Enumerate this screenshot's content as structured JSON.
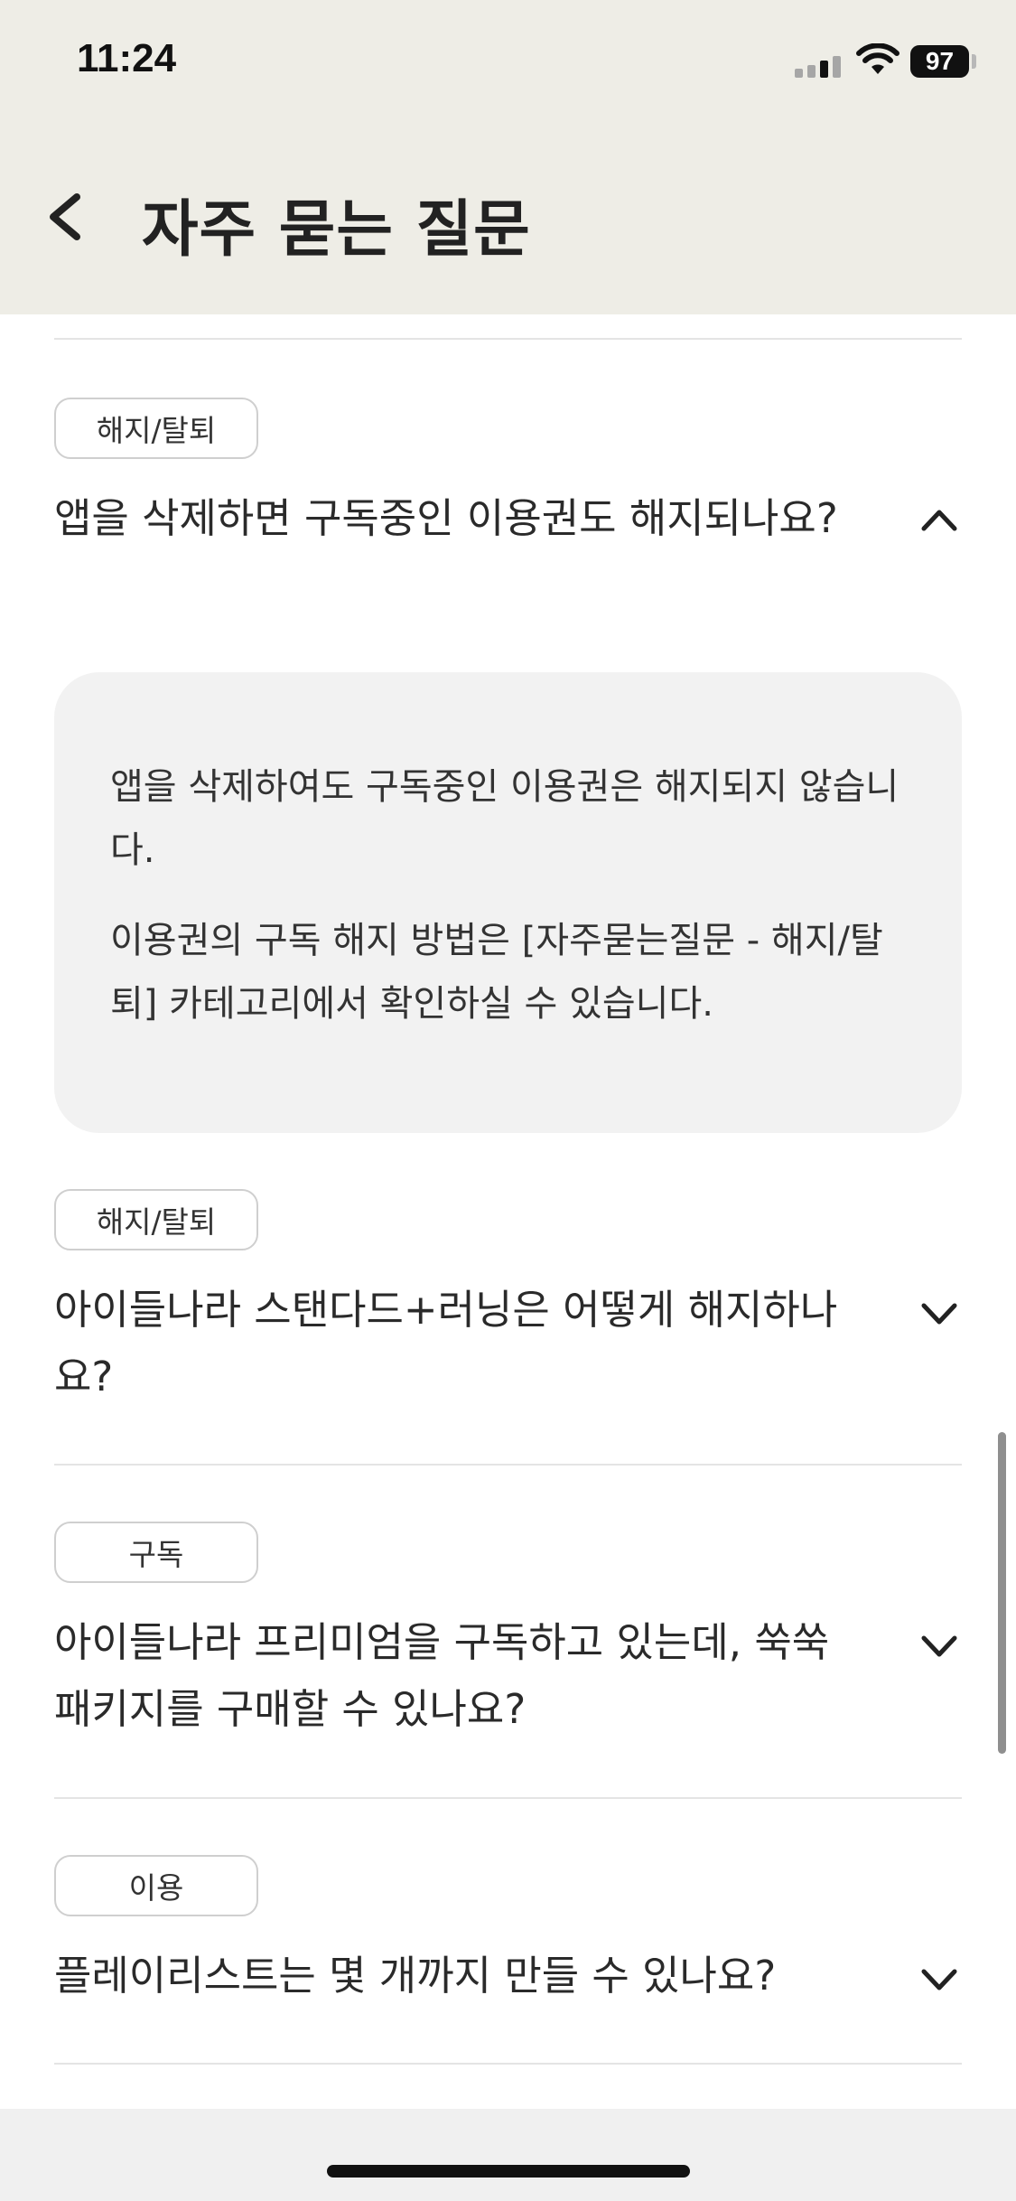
{
  "status_bar": {
    "time": "11:24",
    "battery_level": "97",
    "icons": [
      "cellular-signal-icon",
      "wifi-icon",
      "battery-icon"
    ]
  },
  "header": {
    "back_icon": "chevron-left-icon",
    "title": "자주 묻는 질문"
  },
  "faq_items": [
    {
      "category": "해지/탈퇴",
      "question": "앱을 삭제하면 구독중인 이용권도 해지되나요?",
      "expanded": true,
      "toggle_icon": "chevron-up-icon",
      "answer": [
        "앱을 삭제하여도 구독중인 이용권은 해지되지 않습니다.",
        "이용권의 구독 해지 방법은 [자주묻는질문 - 해지/탈퇴] 카테고리에서 확인하실 수 있습니다."
      ]
    },
    {
      "category": "해지/탈퇴",
      "question": "아이들나라 스탠다드+러닝은 어떻게 해지하나요?",
      "expanded": false,
      "toggle_icon": "chevron-down-icon"
    },
    {
      "category": "구독",
      "question": "아이들나라 프리미엄을 구독하고 있는데, 쑥쑥패키지를 구매할 수 있나요?",
      "expanded": false,
      "toggle_icon": "chevron-down-icon"
    },
    {
      "category": "이용",
      "question": "플레이리스트는 몇 개까지 만들 수 있나요?",
      "expanded": false,
      "toggle_icon": "chevron-down-icon"
    }
  ],
  "colors": {
    "header_background": "#eeede6",
    "answer_background": "#f2f2f2",
    "tag_border": "#cfcfcf",
    "divider": "#e4e4e4"
  }
}
